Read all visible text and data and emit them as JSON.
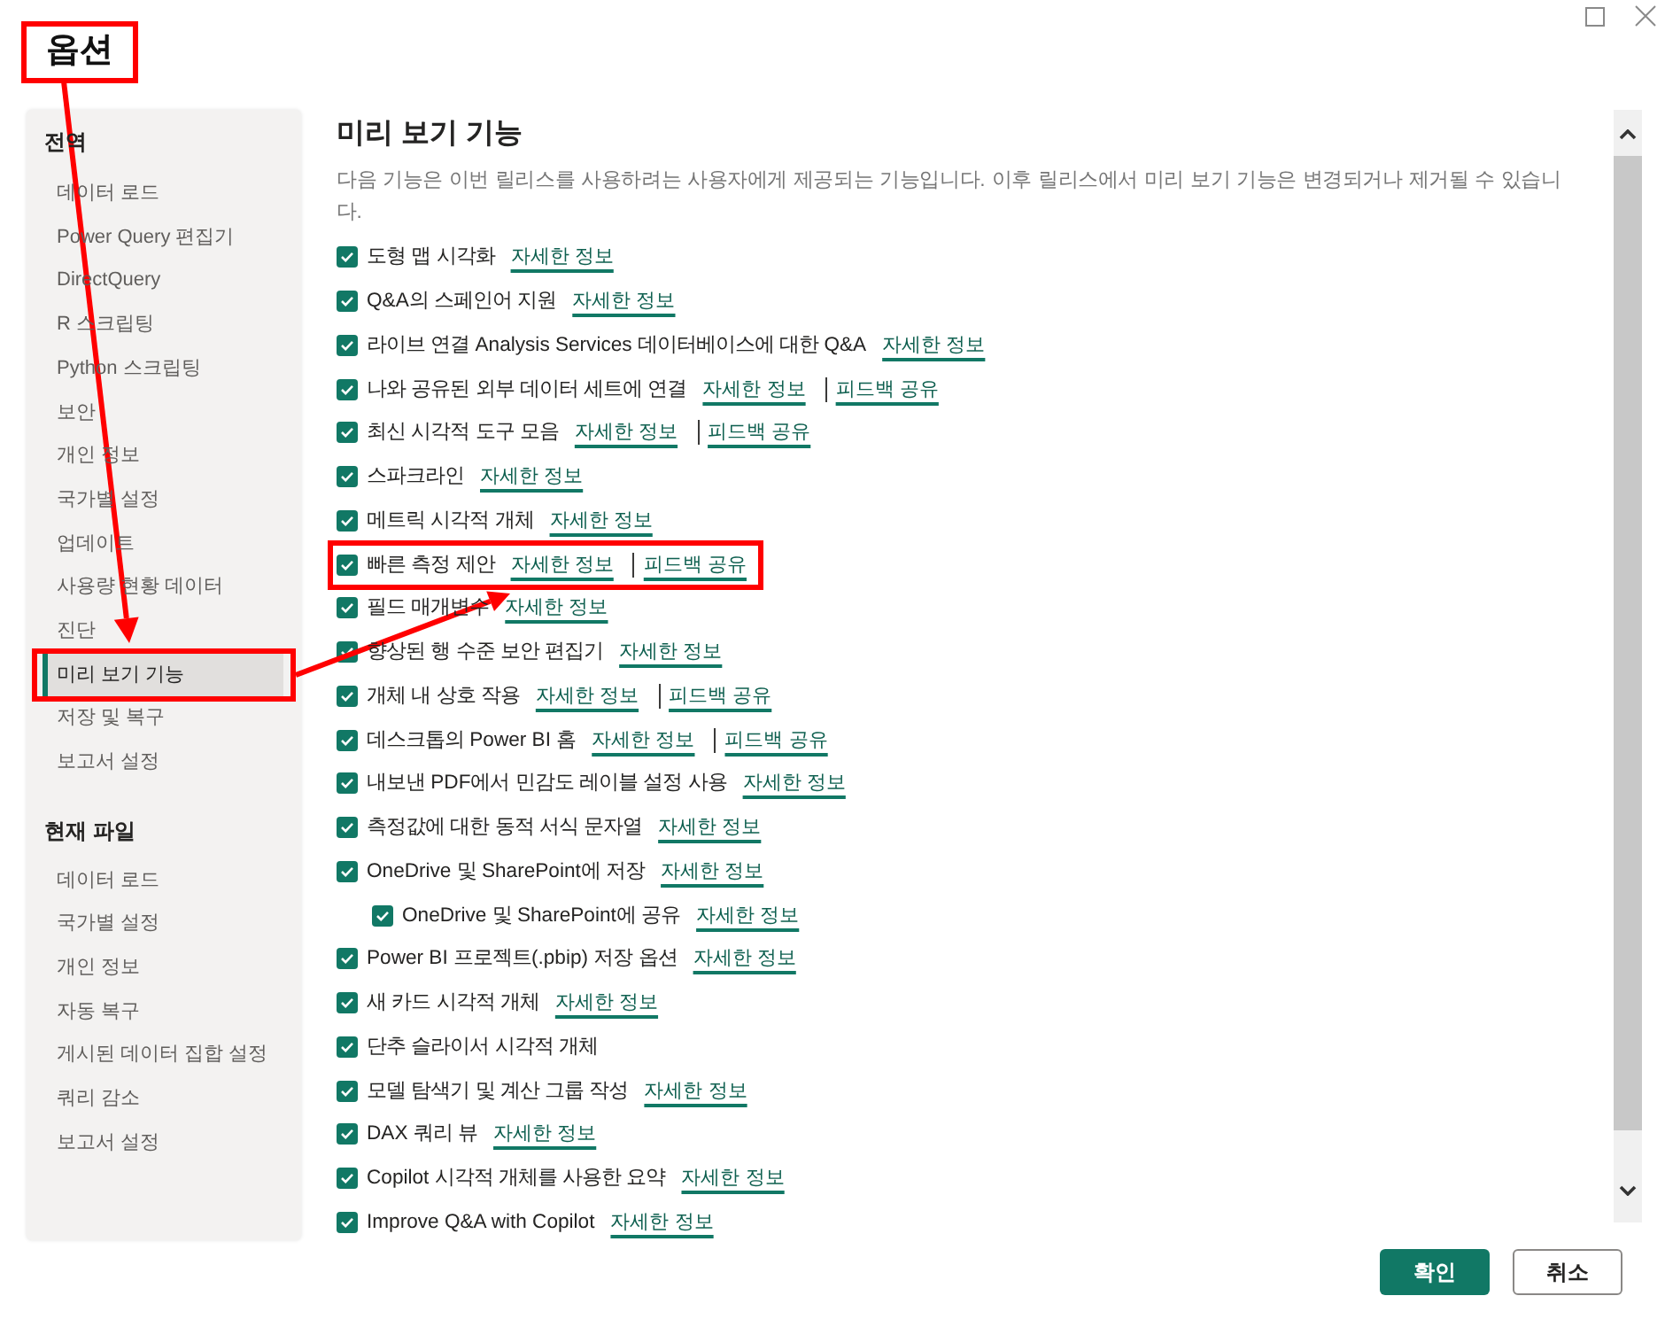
{
  "window": {
    "title": "옵션",
    "title_highlighted": true
  },
  "sidebar": {
    "sections": [
      {
        "heading": "전역",
        "items": [
          {
            "label": "데이터 로드",
            "selected": false,
            "highlighted": false
          },
          {
            "label": "Power Query 편집기",
            "selected": false,
            "highlighted": false
          },
          {
            "label": "DirectQuery",
            "selected": false,
            "highlighted": false
          },
          {
            "label": "R 스크립팅",
            "selected": false,
            "highlighted": false
          },
          {
            "label": "Python 스크립팅",
            "selected": false,
            "highlighted": false
          },
          {
            "label": "보안",
            "selected": false,
            "highlighted": false
          },
          {
            "label": "개인 정보",
            "selected": false,
            "highlighted": false
          },
          {
            "label": "국가별 설정",
            "selected": false,
            "highlighted": false
          },
          {
            "label": "업데이트",
            "selected": false,
            "highlighted": false
          },
          {
            "label": "사용량 현황 데이터",
            "selected": false,
            "highlighted": false
          },
          {
            "label": "진단",
            "selected": false,
            "highlighted": false
          },
          {
            "label": "미리 보기 기능",
            "selected": true,
            "highlighted": true
          },
          {
            "label": "저장 및 복구",
            "selected": false,
            "highlighted": false
          },
          {
            "label": "보고서 설정",
            "selected": false,
            "highlighted": false
          }
        ]
      },
      {
        "heading": "현재 파일",
        "items": [
          {
            "label": "데이터 로드",
            "selected": false,
            "highlighted": false
          },
          {
            "label": "국가별 설정",
            "selected": false,
            "highlighted": false
          },
          {
            "label": "개인 정보",
            "selected": false,
            "highlighted": false
          },
          {
            "label": "자동 복구",
            "selected": false,
            "highlighted": false
          },
          {
            "label": "게시된 데이터 집합 설정",
            "selected": false,
            "highlighted": false
          },
          {
            "label": "쿼리 감소",
            "selected": false,
            "highlighted": false
          },
          {
            "label": "보고서 설정",
            "selected": false,
            "highlighted": false
          }
        ]
      }
    ]
  },
  "page": {
    "title": "미리 보기 기능",
    "description": "다음 기능은 이번 릴리스를 사용하려는 사용자에게 제공되는 기능입니다. 이후 릴리스에서 미리 보기 기능은 변경되거나 제거될 수 있습니다.",
    "features": [
      {
        "label": "도형 맵 시각화",
        "checked": true,
        "highlighted": false,
        "links": [
          {
            "kind": "info",
            "label": "자세한 정보"
          }
        ]
      },
      {
        "label": "Q&A의 스페인어 지원",
        "checked": true,
        "highlighted": false,
        "links": [
          {
            "kind": "info",
            "label": "자세한 정보"
          }
        ]
      },
      {
        "label": "라이브 연결 Analysis Services 데이터베이스에 대한 Q&A",
        "checked": true,
        "highlighted": false,
        "links": [
          {
            "kind": "info",
            "label": "자세한 정보"
          }
        ]
      },
      {
        "label": "나와 공유된 외부 데이터 세트에 연결",
        "checked": true,
        "highlighted": false,
        "links": [
          {
            "kind": "info",
            "label": "자세한 정보"
          },
          {
            "kind": "feedback",
            "label": "피드백 공유"
          }
        ]
      },
      {
        "label": "최신 시각적 도구 모음",
        "checked": true,
        "highlighted": false,
        "links": [
          {
            "kind": "info",
            "label": "자세한 정보"
          },
          {
            "kind": "feedback",
            "label": "피드백 공유"
          }
        ]
      },
      {
        "label": "스파크라인",
        "checked": true,
        "highlighted": false,
        "links": [
          {
            "kind": "info",
            "label": "자세한 정보"
          }
        ]
      },
      {
        "label": "메트릭 시각적 개체",
        "checked": true,
        "highlighted": false,
        "links": [
          {
            "kind": "info",
            "label": "자세한 정보"
          }
        ]
      },
      {
        "label": "빠른 측정 제안",
        "checked": true,
        "highlighted": true,
        "links": [
          {
            "kind": "info",
            "label": "자세한 정보"
          },
          {
            "kind": "feedback",
            "label": "피드백 공유"
          }
        ]
      },
      {
        "label": "필드 매개변수",
        "checked": true,
        "highlighted": false,
        "links": [
          {
            "kind": "info",
            "label": "자세한 정보"
          }
        ]
      },
      {
        "label": "향상된 행 수준 보안 편집기",
        "checked": true,
        "highlighted": false,
        "links": [
          {
            "kind": "info",
            "label": "자세한 정보"
          }
        ]
      },
      {
        "label": "개체 내 상호 작용",
        "checked": true,
        "highlighted": false,
        "links": [
          {
            "kind": "info",
            "label": "자세한 정보"
          },
          {
            "kind": "feedback",
            "label": "피드백 공유"
          }
        ]
      },
      {
        "label": "데스크톱의 Power BI 홈",
        "checked": true,
        "highlighted": false,
        "links": [
          {
            "kind": "info",
            "label": "자세한 정보"
          },
          {
            "kind": "feedback",
            "label": "피드백 공유"
          }
        ]
      },
      {
        "label": "내보낸 PDF에서 민감도 레이블 설정 사용",
        "checked": true,
        "highlighted": false,
        "links": [
          {
            "kind": "info",
            "label": "자세한 정보"
          }
        ]
      },
      {
        "label": "측정값에 대한 동적 서식 문자열",
        "checked": true,
        "highlighted": false,
        "links": [
          {
            "kind": "info",
            "label": "자세한 정보"
          }
        ]
      },
      {
        "label": "OneDrive 및 SharePoint에 저장",
        "checked": true,
        "highlighted": false,
        "links": [
          {
            "kind": "info",
            "label": "자세한 정보"
          }
        ],
        "children": [
          {
            "label": "OneDrive 및 SharePoint에 공유",
            "checked": true,
            "highlighted": false,
            "links": [
              {
                "kind": "info",
                "label": "자세한 정보"
              }
            ]
          }
        ]
      },
      {
        "label": "Power BI 프로젝트(.pbip) 저장 옵션",
        "checked": true,
        "highlighted": false,
        "links": [
          {
            "kind": "info",
            "label": "자세한 정보"
          }
        ]
      },
      {
        "label": "새 카드 시각적 개체",
        "checked": true,
        "highlighted": false,
        "links": [
          {
            "kind": "info",
            "label": "자세한 정보"
          }
        ]
      },
      {
        "label": "단추 슬라이서 시각적 개체",
        "checked": true,
        "highlighted": false
      },
      {
        "label": "모델 탐색기 및 계산 그룹 작성",
        "checked": true,
        "highlighted": false,
        "links": [
          {
            "kind": "info",
            "label": "자세한 정보"
          }
        ]
      },
      {
        "label": "DAX 쿼리 뷰",
        "checked": true,
        "highlighted": false,
        "links": [
          {
            "kind": "info",
            "label": "자세한 정보"
          }
        ]
      },
      {
        "label": "Copilot 시각적 개체를 사용한 요약",
        "checked": true,
        "highlighted": false,
        "links": [
          {
            "kind": "info",
            "label": "자세한 정보"
          }
        ]
      },
      {
        "label": "Improve Q&A with Copilot",
        "checked": true,
        "highlighted": false,
        "links": [
          {
            "kind": "info",
            "label": "자세한 정보"
          }
        ]
      }
    ]
  },
  "buttons": [
    {
      "kind": "primary",
      "label": "확인"
    },
    {
      "kind": "secondary",
      "label": "취소"
    }
  ]
}
